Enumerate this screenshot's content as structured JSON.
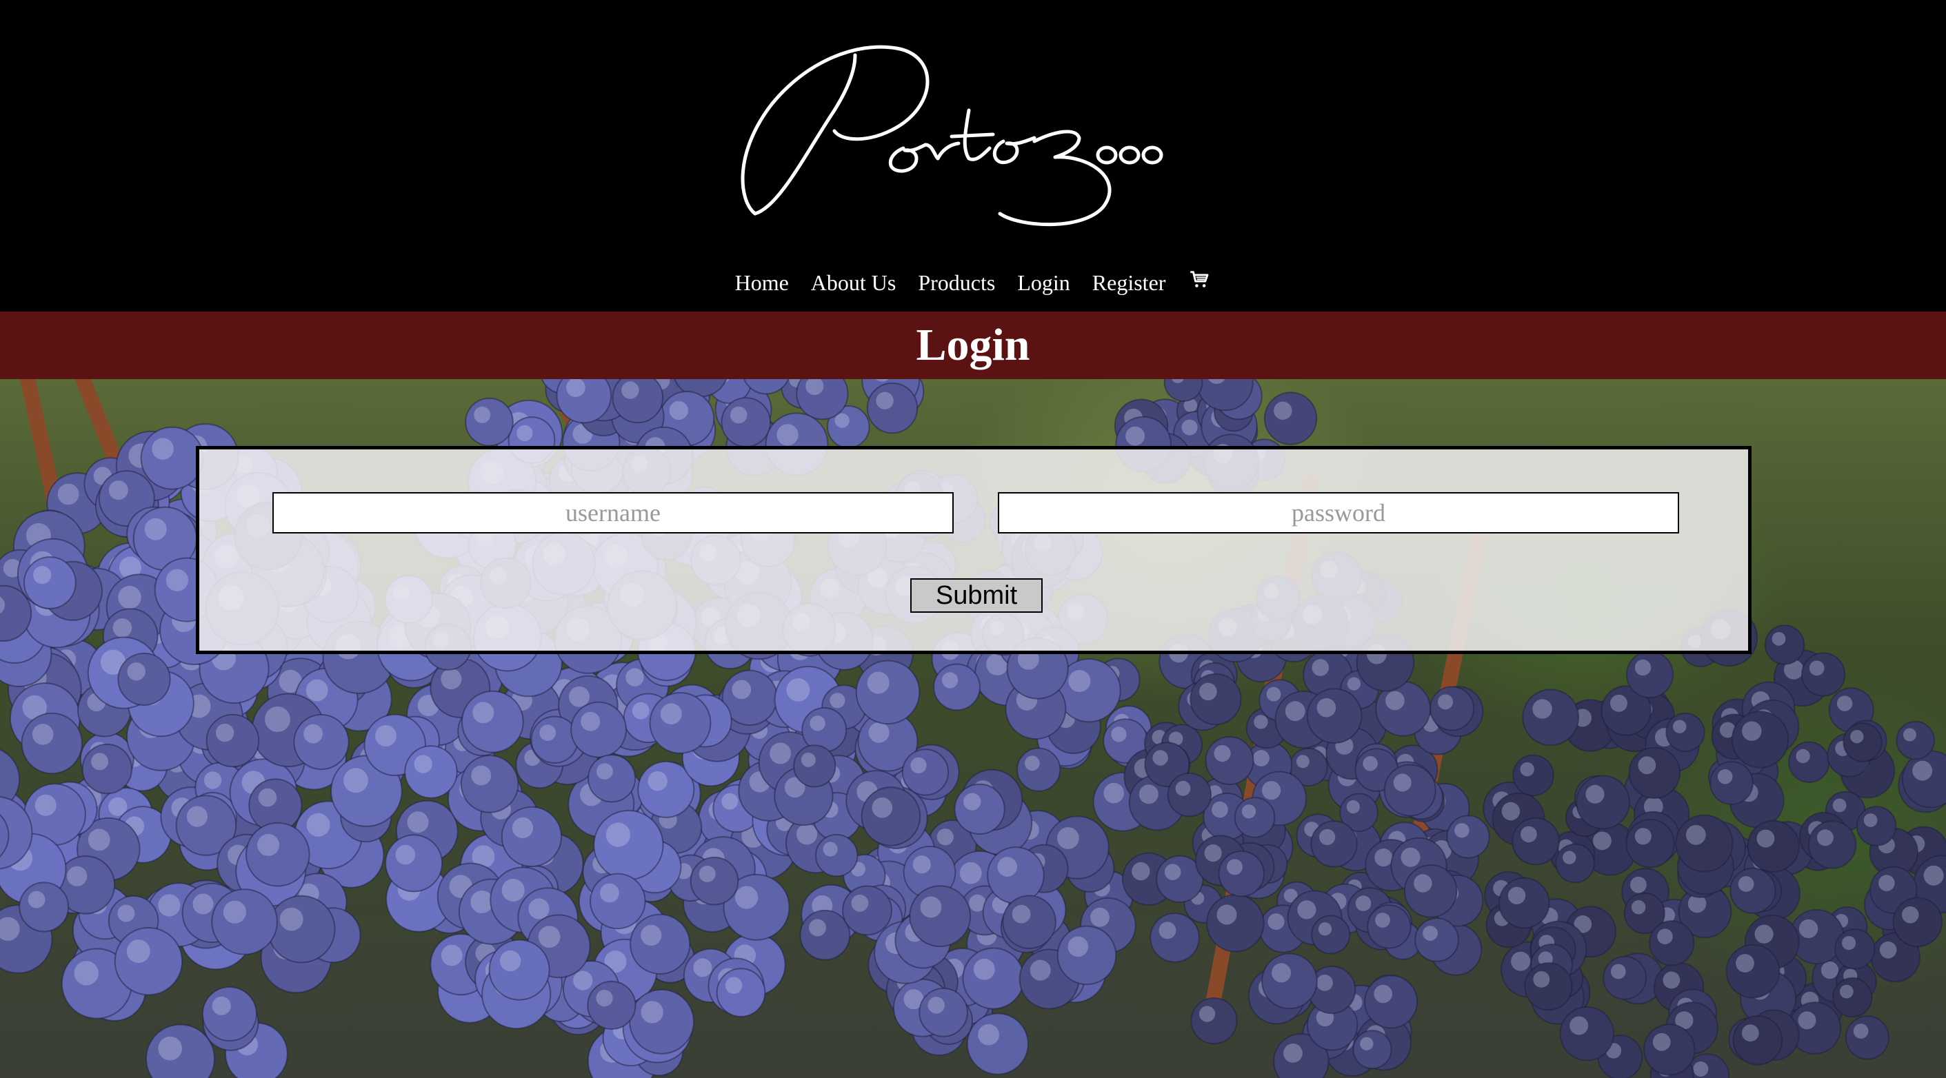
{
  "brand": {
    "logo_text": "Porto 3ooo"
  },
  "nav": {
    "items": [
      {
        "label": "Home"
      },
      {
        "label": "About Us"
      },
      {
        "label": "Products"
      },
      {
        "label": "Login"
      },
      {
        "label": "Register"
      }
    ],
    "cart_icon": "shopping-cart-icon"
  },
  "page": {
    "title": "Login"
  },
  "form": {
    "username_placeholder": "username",
    "password_placeholder": "password",
    "submit_label": "Submit"
  },
  "colors": {
    "header_bg": "#000000",
    "title_band_bg": "#5a1212",
    "form_bg": "#f0f0f0",
    "grape": "#5f6aa6"
  }
}
